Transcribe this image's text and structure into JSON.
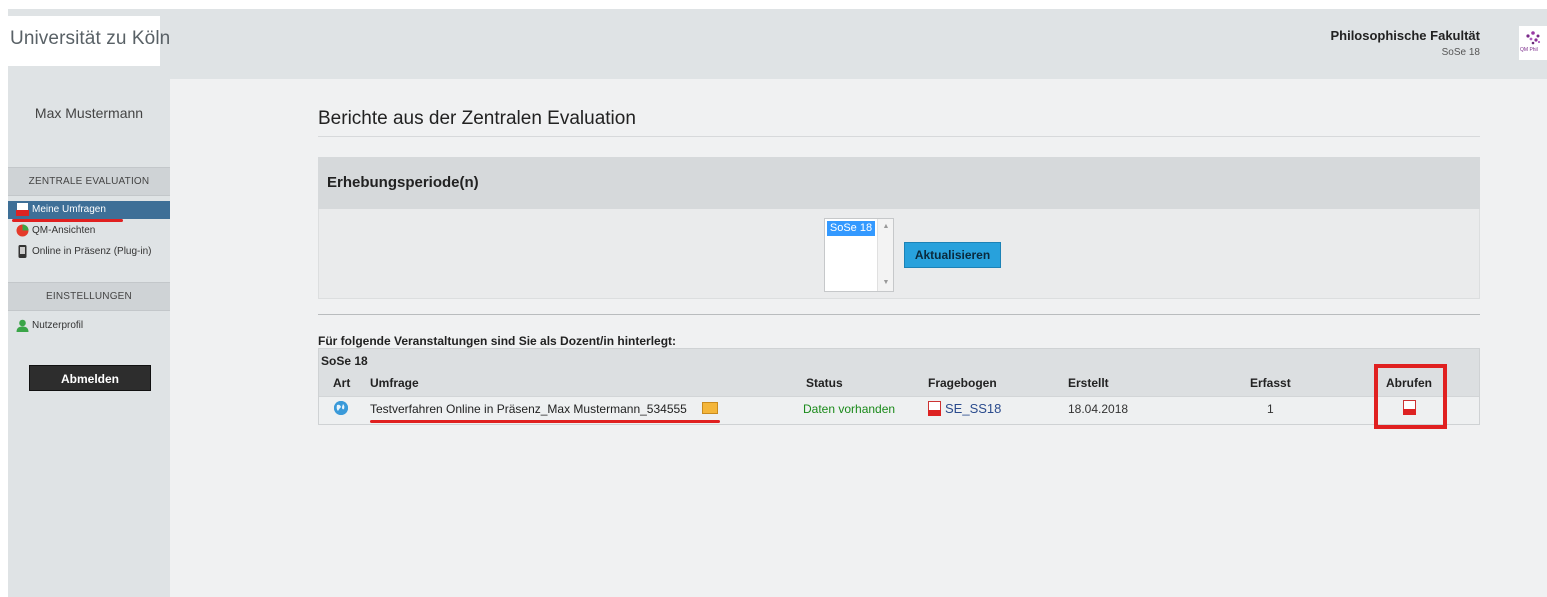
{
  "header": {
    "university": "Universität zu Köln",
    "faculty": "Philosophische Fakultät",
    "semester": "SoSe 18",
    "faculty_logo_icon": "qm-phil-logo-icon"
  },
  "sidebar": {
    "user_name": "Max Mustermann",
    "sections": [
      {
        "title": "ZENTRALE EVALUATION",
        "items": [
          {
            "label": "Meine Umfragen",
            "icon": "pdf-icon",
            "active": true
          },
          {
            "label": "QM-Ansichten",
            "icon": "pie-chart-icon",
            "active": false
          },
          {
            "label": "Online in Präsenz (Plug-in)",
            "icon": "phone-icon",
            "active": false
          }
        ]
      },
      {
        "title": "EINSTELLUNGEN",
        "items": [
          {
            "label": "Nutzerprofil",
            "icon": "user-icon",
            "active": false
          }
        ]
      }
    ],
    "logout_label": "Abmelden"
  },
  "main": {
    "title": "Berichte aus der Zentralen Evaluation",
    "period_panel": {
      "title": "Erhebungsperiode(n)",
      "options": [
        "SoSe 18"
      ],
      "selected": "SoSe 18",
      "refresh_label": "Aktualisieren"
    },
    "courses_heading": "Für folgende Veranstaltungen sind Sie als Dozent/in hinterlegt:",
    "table": {
      "term": "SoSe 18",
      "columns": [
        "Art",
        "Umfrage",
        "Status",
        "Fragebogen",
        "Erstellt",
        "Erfasst",
        "Abrufen"
      ],
      "rows": [
        {
          "type_icon": "globe-icon",
          "survey": "Testverfahren Online in Präsenz_Max Mustermann_534555",
          "status": "Daten vorhanden",
          "form": "SE_SS18",
          "created": "18.04.2018",
          "captured": "1",
          "download_icon": "pdf-icon"
        }
      ]
    }
  },
  "colors": {
    "accent_active": "#3e6f97",
    "button_blue": "#28a1dc",
    "status_green": "#1a8a1a",
    "annotation_red": "#e02020"
  }
}
